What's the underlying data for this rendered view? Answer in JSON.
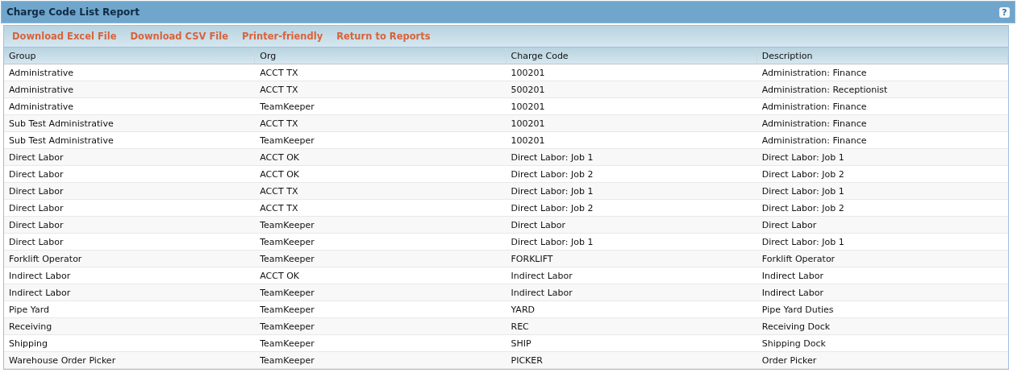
{
  "window": {
    "title": "Charge Code List Report",
    "help": "?"
  },
  "toolbar": [
    "Download Excel File",
    "Download CSV File",
    "Printer-friendly",
    "Return to Reports"
  ],
  "table": {
    "columns": [
      "Group",
      "Org",
      "Charge Code",
      "Description"
    ],
    "rows": [
      [
        "Administrative",
        "ACCT TX",
        "100201",
        "Administration: Finance"
      ],
      [
        "Administrative",
        "ACCT TX",
        "500201",
        "Administration: Receptionist"
      ],
      [
        "Administrative",
        "TeamKeeper",
        "100201",
        "Administration: Finance"
      ],
      [
        "Sub Test Administrative",
        "ACCT TX",
        "100201",
        "Administration: Finance"
      ],
      [
        "Sub Test Administrative",
        "TeamKeeper",
        "100201",
        "Administration: Finance"
      ],
      [
        "Direct Labor",
        "ACCT OK",
        "Direct Labor: Job 1",
        "Direct Labor: Job 1"
      ],
      [
        "Direct Labor",
        "ACCT OK",
        "Direct Labor: Job 2",
        "Direct Labor: Job 2"
      ],
      [
        "Direct Labor",
        "ACCT TX",
        "Direct Labor: Job 1",
        "Direct Labor: Job 1"
      ],
      [
        "Direct Labor",
        "ACCT TX",
        "Direct Labor: Job 2",
        "Direct Labor: Job 2"
      ],
      [
        "Direct Labor",
        "TeamKeeper",
        "Direct Labor",
        "Direct Labor"
      ],
      [
        "Direct Labor",
        "TeamKeeper",
        "Direct Labor: Job 1",
        "Direct Labor: Job 1"
      ],
      [
        "Forklift Operator",
        "TeamKeeper",
        "FORKLIFT",
        "Forklift Operator"
      ],
      [
        "Indirect Labor",
        "ACCT OK",
        "Indirect Labor",
        "Indirect Labor"
      ],
      [
        "Indirect Labor",
        "TeamKeeper",
        "Indirect Labor",
        "Indirect Labor"
      ],
      [
        "Pipe Yard",
        "TeamKeeper",
        "YARD",
        "Pipe Yard Duties"
      ],
      [
        "Receiving",
        "TeamKeeper",
        "REC",
        "Receiving Dock"
      ],
      [
        "Shipping",
        "TeamKeeper",
        "SHIP",
        "Shipping Dock"
      ],
      [
        "Warehouse Order Picker",
        "TeamKeeper",
        "PICKER",
        "Order Picker"
      ]
    ]
  }
}
